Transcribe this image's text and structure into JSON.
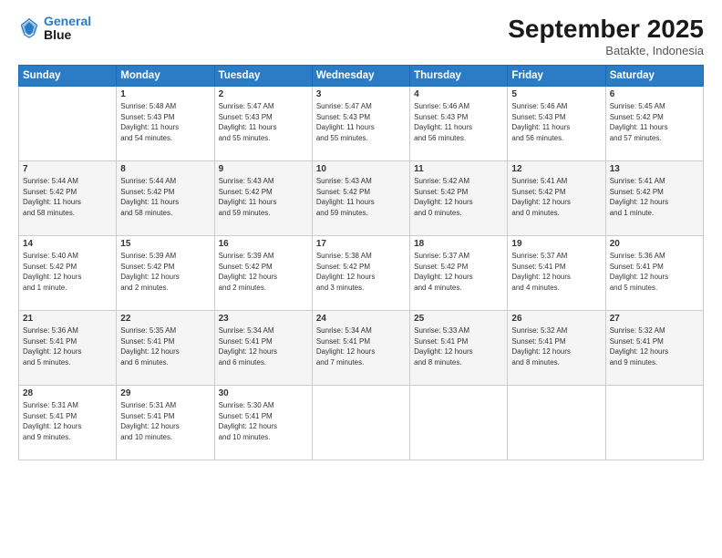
{
  "logo": {
    "line1": "General",
    "line2": "Blue"
  },
  "header": {
    "month": "September 2025",
    "location": "Batakte, Indonesia"
  },
  "days": [
    "Sunday",
    "Monday",
    "Tuesday",
    "Wednesday",
    "Thursday",
    "Friday",
    "Saturday"
  ],
  "weeks": [
    [
      {
        "num": "",
        "info": ""
      },
      {
        "num": "1",
        "info": "Sunrise: 5:48 AM\nSunset: 5:43 PM\nDaylight: 11 hours\nand 54 minutes."
      },
      {
        "num": "2",
        "info": "Sunrise: 5:47 AM\nSunset: 5:43 PM\nDaylight: 11 hours\nand 55 minutes."
      },
      {
        "num": "3",
        "info": "Sunrise: 5:47 AM\nSunset: 5:43 PM\nDaylight: 11 hours\nand 55 minutes."
      },
      {
        "num": "4",
        "info": "Sunrise: 5:46 AM\nSunset: 5:43 PM\nDaylight: 11 hours\nand 56 minutes."
      },
      {
        "num": "5",
        "info": "Sunrise: 5:46 AM\nSunset: 5:43 PM\nDaylight: 11 hours\nand 56 minutes."
      },
      {
        "num": "6",
        "info": "Sunrise: 5:45 AM\nSunset: 5:42 PM\nDaylight: 11 hours\nand 57 minutes."
      }
    ],
    [
      {
        "num": "7",
        "info": "Sunrise: 5:44 AM\nSunset: 5:42 PM\nDaylight: 11 hours\nand 58 minutes."
      },
      {
        "num": "8",
        "info": "Sunrise: 5:44 AM\nSunset: 5:42 PM\nDaylight: 11 hours\nand 58 minutes."
      },
      {
        "num": "9",
        "info": "Sunrise: 5:43 AM\nSunset: 5:42 PM\nDaylight: 11 hours\nand 59 minutes."
      },
      {
        "num": "10",
        "info": "Sunrise: 5:43 AM\nSunset: 5:42 PM\nDaylight: 11 hours\nand 59 minutes."
      },
      {
        "num": "11",
        "info": "Sunrise: 5:42 AM\nSunset: 5:42 PM\nDaylight: 12 hours\nand 0 minutes."
      },
      {
        "num": "12",
        "info": "Sunrise: 5:41 AM\nSunset: 5:42 PM\nDaylight: 12 hours\nand 0 minutes."
      },
      {
        "num": "13",
        "info": "Sunrise: 5:41 AM\nSunset: 5:42 PM\nDaylight: 12 hours\nand 1 minute."
      }
    ],
    [
      {
        "num": "14",
        "info": "Sunrise: 5:40 AM\nSunset: 5:42 PM\nDaylight: 12 hours\nand 1 minute."
      },
      {
        "num": "15",
        "info": "Sunrise: 5:39 AM\nSunset: 5:42 PM\nDaylight: 12 hours\nand 2 minutes."
      },
      {
        "num": "16",
        "info": "Sunrise: 5:39 AM\nSunset: 5:42 PM\nDaylight: 12 hours\nand 2 minutes."
      },
      {
        "num": "17",
        "info": "Sunrise: 5:38 AM\nSunset: 5:42 PM\nDaylight: 12 hours\nand 3 minutes."
      },
      {
        "num": "18",
        "info": "Sunrise: 5:37 AM\nSunset: 5:42 PM\nDaylight: 12 hours\nand 4 minutes."
      },
      {
        "num": "19",
        "info": "Sunrise: 5:37 AM\nSunset: 5:41 PM\nDaylight: 12 hours\nand 4 minutes."
      },
      {
        "num": "20",
        "info": "Sunrise: 5:36 AM\nSunset: 5:41 PM\nDaylight: 12 hours\nand 5 minutes."
      }
    ],
    [
      {
        "num": "21",
        "info": "Sunrise: 5:36 AM\nSunset: 5:41 PM\nDaylight: 12 hours\nand 5 minutes."
      },
      {
        "num": "22",
        "info": "Sunrise: 5:35 AM\nSunset: 5:41 PM\nDaylight: 12 hours\nand 6 minutes."
      },
      {
        "num": "23",
        "info": "Sunrise: 5:34 AM\nSunset: 5:41 PM\nDaylight: 12 hours\nand 6 minutes."
      },
      {
        "num": "24",
        "info": "Sunrise: 5:34 AM\nSunset: 5:41 PM\nDaylight: 12 hours\nand 7 minutes."
      },
      {
        "num": "25",
        "info": "Sunrise: 5:33 AM\nSunset: 5:41 PM\nDaylight: 12 hours\nand 8 minutes."
      },
      {
        "num": "26",
        "info": "Sunrise: 5:32 AM\nSunset: 5:41 PM\nDaylight: 12 hours\nand 8 minutes."
      },
      {
        "num": "27",
        "info": "Sunrise: 5:32 AM\nSunset: 5:41 PM\nDaylight: 12 hours\nand 9 minutes."
      }
    ],
    [
      {
        "num": "28",
        "info": "Sunrise: 5:31 AM\nSunset: 5:41 PM\nDaylight: 12 hours\nand 9 minutes."
      },
      {
        "num": "29",
        "info": "Sunrise: 5:31 AM\nSunset: 5:41 PM\nDaylight: 12 hours\nand 10 minutes."
      },
      {
        "num": "30",
        "info": "Sunrise: 5:30 AM\nSunset: 5:41 PM\nDaylight: 12 hours\nand 10 minutes."
      },
      {
        "num": "",
        "info": ""
      },
      {
        "num": "",
        "info": ""
      },
      {
        "num": "",
        "info": ""
      },
      {
        "num": "",
        "info": ""
      }
    ]
  ]
}
